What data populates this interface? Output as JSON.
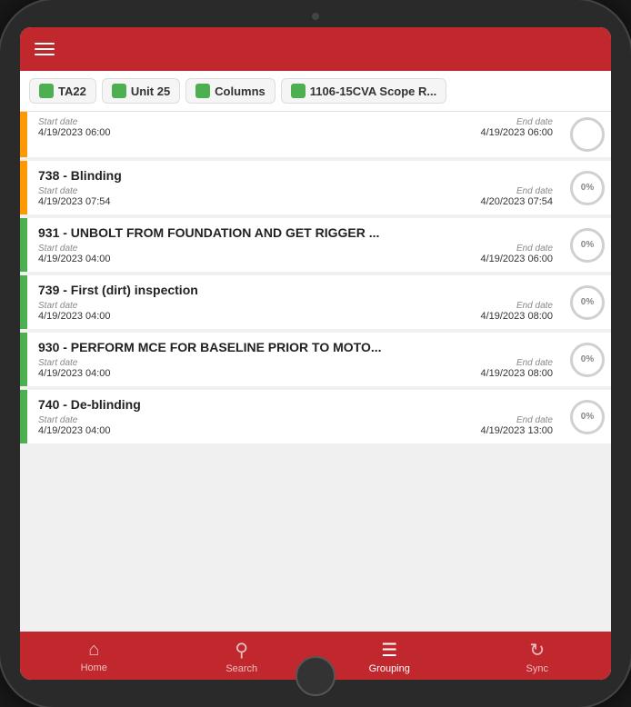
{
  "header": {
    "menu_icon": "☰"
  },
  "tabs": [
    {
      "label": "TA22",
      "color": "#4caf50"
    },
    {
      "label": "Unit 25",
      "color": "#4caf50"
    },
    {
      "label": "Columns",
      "color": "#4caf50"
    },
    {
      "label": "1106-15CVA Scope R...",
      "color": "#4caf50"
    }
  ],
  "list_items": [
    {
      "id": "item-0",
      "bar_color": "#ff9800",
      "title": null,
      "start_label": "Start date",
      "start_value": "4/19/2023 06:00",
      "end_label": "End date",
      "end_value": "4/19/2023 06:00",
      "progress": null,
      "simple": true
    },
    {
      "id": "item-1",
      "bar_color": "#ff9800",
      "title": "738 - Blinding",
      "start_label": "Start date",
      "start_value": "4/19/2023 07:54",
      "end_label": "End date",
      "end_value": "4/20/2023 07:54",
      "progress": "0%"
    },
    {
      "id": "item-2",
      "bar_color": "#4caf50",
      "title": "931 - UNBOLT FROM FOUNDATION AND GET RIGGER ...",
      "start_label": "Start date",
      "start_value": "4/19/2023 04:00",
      "end_label": "End date",
      "end_value": "4/19/2023 06:00",
      "progress": "0%"
    },
    {
      "id": "item-3",
      "bar_color": "#4caf50",
      "title": "739 - First (dirt) inspection",
      "start_label": "Start date",
      "start_value": "4/19/2023 04:00",
      "end_label": "End date",
      "end_value": "4/19/2023 08:00",
      "progress": "0%"
    },
    {
      "id": "item-4",
      "bar_color": "#4caf50",
      "title": "930 - PERFORM MCE FOR BASELINE PRIOR TO MOTO...",
      "start_label": "Start date",
      "start_value": "4/19/2023 04:00",
      "end_label": "End date",
      "end_value": "4/19/2023 08:00",
      "progress": "0%"
    },
    {
      "id": "item-5",
      "bar_color": "#4caf50",
      "title": "740 - De-blinding",
      "start_label": "Start date",
      "start_value": "4/19/2023 04:00",
      "end_label": "End date",
      "end_value": "4/19/2023 13:00",
      "progress": "0%"
    }
  ],
  "bottom_nav": [
    {
      "id": "nav-home",
      "label": "Home",
      "icon": "⌂",
      "active": false
    },
    {
      "id": "nav-search",
      "label": "Search",
      "icon": "⚲",
      "active": false
    },
    {
      "id": "nav-grouping",
      "label": "Grouping",
      "icon": "☰",
      "active": true
    },
    {
      "id": "nav-sync",
      "label": "Sync",
      "icon": "↻",
      "active": false
    }
  ]
}
